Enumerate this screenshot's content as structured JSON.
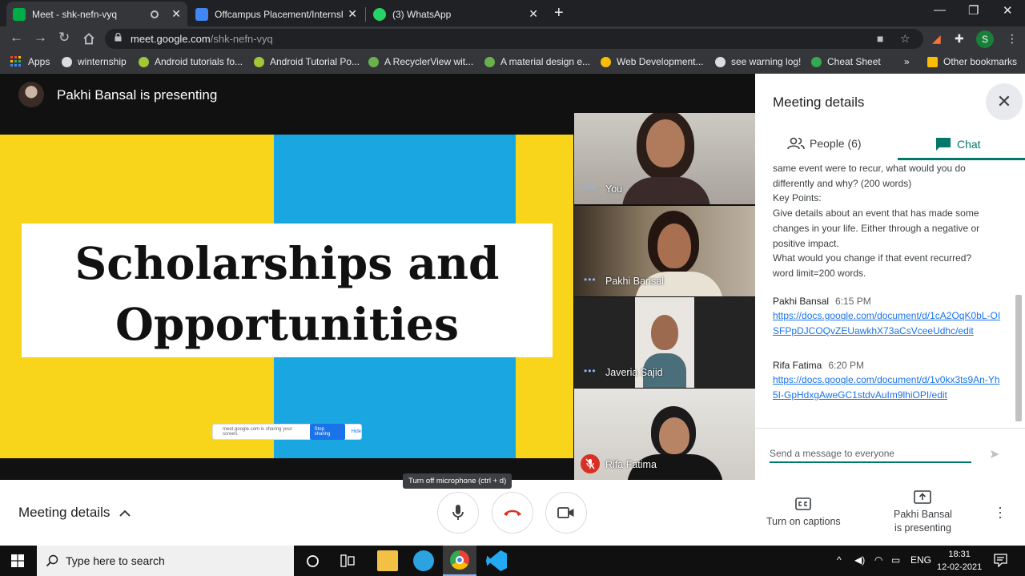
{
  "browser": {
    "tabs": [
      {
        "title": "Meet - shk-nefn-vyq",
        "active": true
      },
      {
        "title": "Offcampus Placement/Internship",
        "active": false
      },
      {
        "title": "(3) WhatsApp",
        "active": false
      }
    ],
    "close_glyph": "✕",
    "url": {
      "host": "meet.google.com",
      "path": "/shk-nefn-vyq"
    },
    "profile_initial": "S",
    "bookmarks": [
      "Apps",
      "winternship",
      "Android tutorials fo...",
      "Android Tutorial Po...",
      "A RecyclerView wit...",
      "A material design e...",
      "Web Development...",
      "see warning log!",
      "Cheat Sheet"
    ],
    "bookmarks_overflow": "»",
    "other_bookmarks": "Other bookmarks"
  },
  "meet": {
    "presenter_banner": "Pakhi Bansal is presenting",
    "slide": {
      "title_line1": "Scholarships and",
      "title_line2": "Opportunities",
      "share_message": "meet.google.com is sharing your screen.",
      "stop_sharing": "Stop sharing",
      "hide": "Hide"
    },
    "participants": [
      {
        "name": "You",
        "muted": false
      },
      {
        "name": "Pakhi Bansal",
        "muted": false
      },
      {
        "name": "Javeria Sajid",
        "muted": false
      },
      {
        "name": "Rifa Fatima",
        "muted": true
      }
    ],
    "tile_dots": "•••",
    "panel": {
      "title": "Meeting details",
      "tab_people": "People (6)",
      "tab_chat": "Chat",
      "active_tab": "Chat",
      "messages": [
        {
          "lines": [
            "same event were to recur, what would you do differently and why? (200 words)",
            "Key Points:",
            "Give details about an event that has made some changes in your life. Either through a negative or positive impact.",
            "What would you change if that event recurred?",
            "word limit=200 words."
          ]
        },
        {
          "sender": "Pakhi Bansal",
          "time": "6:15 PM",
          "link": "https://docs.google.com/document/d/1cA2OqK0bL-OISFPpDJCOQvZEUawkhX73aCsVceeUdhc/edit"
        },
        {
          "sender": "Rifa Fatima",
          "time": "6:20 PM",
          "link": "https://docs.google.com/document/d/1v0kx3ts9An-Yh5I-GpHdxgAweGC1stdvAuIm9lhiOPI/edit"
        }
      ],
      "input_placeholder": "Send a message to everyone"
    },
    "bottom": {
      "meeting_details": "Meeting details",
      "tooltip": "Turn off microphone (ctrl + d)",
      "captions": "Turn on captions",
      "presenting_line1": "Pakhi Bansal",
      "presenting_line2": "is presenting"
    },
    "colors": {
      "accent": "#00796b",
      "link": "#1a73e8",
      "hangup": "#d93025",
      "slide_yellow": "#f8d41b",
      "slide_blue": "#1aa6e0"
    }
  },
  "taskbar": {
    "search_placeholder": "Type here to search",
    "language": "ENG",
    "time": "18:31",
    "date": "12-02-2021"
  }
}
